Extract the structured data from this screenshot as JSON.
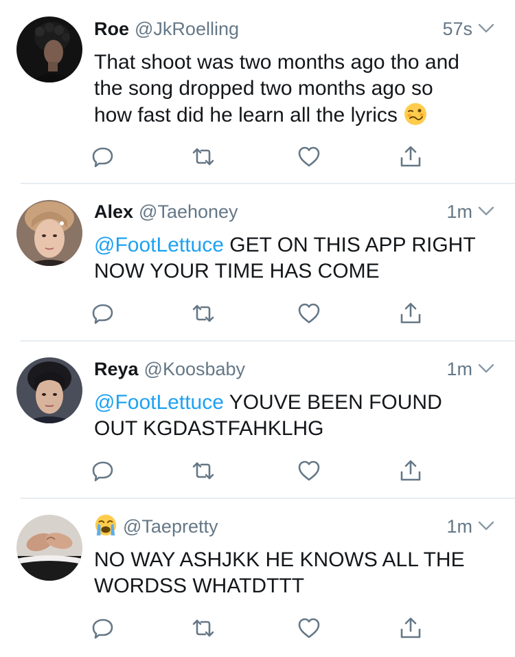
{
  "tweets": [
    {
      "name": "Roe",
      "handle": "@JkRoelling",
      "time": "57s",
      "lines": [
        "That shoot was two months ago tho and",
        "the song dropped two months ago so",
        "how fast did he learn all the lyrics"
      ],
      "body_emoji": "woozy-face-emoji",
      "avatar": "dark-curly-hair-portrait"
    },
    {
      "name": "Alex",
      "handle": "@Taehoney",
      "time": "1m",
      "mention": "@FootLettuce",
      "lines": [
        " GET ON THIS APP RIGHT",
        "NOW YOUR TIME HAS COME"
      ],
      "avatar": "light-hair-portrait"
    },
    {
      "name": "Reya",
      "handle": "@Koosbaby",
      "time": "1m",
      "mention": "@FootLettuce",
      "lines": [
        " YOUVE BEEN FOUND",
        "OUT KGDASTFAHKLHG"
      ],
      "avatar": "dark-hair-portrait"
    },
    {
      "name_emoji": "loudly-crying-face-emoji",
      "handle": "@Taepretty",
      "time": "1m",
      "lines": [
        "NO WAY ASHJKK HE KNOWS ALL THE",
        "WORDSS WHATDTTT"
      ],
      "avatar": "hands-photo"
    }
  ],
  "actions": [
    "reply-icon",
    "retweet-icon",
    "like-icon",
    "share-icon"
  ],
  "colors": {
    "mention": "#1da1f2",
    "secondary_text": "#657786",
    "divider": "#e6ecf0",
    "icon": "#657786"
  }
}
